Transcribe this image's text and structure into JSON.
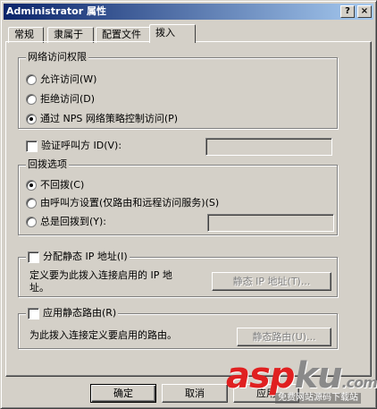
{
  "window": {
    "title": "Administrator 属性",
    "help_btn": "?",
    "close_btn": "×"
  },
  "tabs": [
    {
      "label": "常规"
    },
    {
      "label": "隶属于"
    },
    {
      "label": "配置文件"
    },
    {
      "label": "拨入",
      "active": true
    }
  ],
  "network_access": {
    "label": "网络访问权限",
    "options": [
      {
        "label": "允许访问(W)",
        "selected": false
      },
      {
        "label": "拒绝访问(D)",
        "selected": false
      },
      {
        "label": "通过 NPS 网络策略控制访问(P)",
        "selected": true
      }
    ]
  },
  "verify_caller": {
    "label": "验证呼叫方 ID(V):",
    "checked": false,
    "value": ""
  },
  "callback": {
    "label": "回拨选项",
    "options": [
      {
        "label": "不回拨(C)",
        "selected": true
      },
      {
        "label": "由呼叫方设置(仅路由和远程访问服务)(S)",
        "selected": false
      },
      {
        "label": "总是回拨到(Y):",
        "selected": false
      }
    ],
    "value": ""
  },
  "static_ip": {
    "label": "分配静态 IP 地址(I)",
    "checked": false,
    "desc_line1": "定义要为此拨入连接启用的 IP 地",
    "desc_line2": "址。",
    "button": "静态 IP 地址(T)..."
  },
  "static_routes": {
    "label": "应用静态路由(R)",
    "checked": false,
    "desc": "为此拨入连接定义要启用的路由。",
    "button": "静态路由(U)..."
  },
  "footer": {
    "ok": "确定",
    "cancel": "取消",
    "apply": "应用"
  },
  "watermark": {
    "logo_part1": "asp",
    "logo_part2": "ku",
    "logo_suffix": ".com",
    "subtitle": "免费网站源码下载站"
  },
  "colors": {
    "titlebar_start": "#0a246a",
    "titlebar_end": "#a6caf0",
    "face": "#d4d0c8",
    "watermark_red": "#e02020"
  }
}
